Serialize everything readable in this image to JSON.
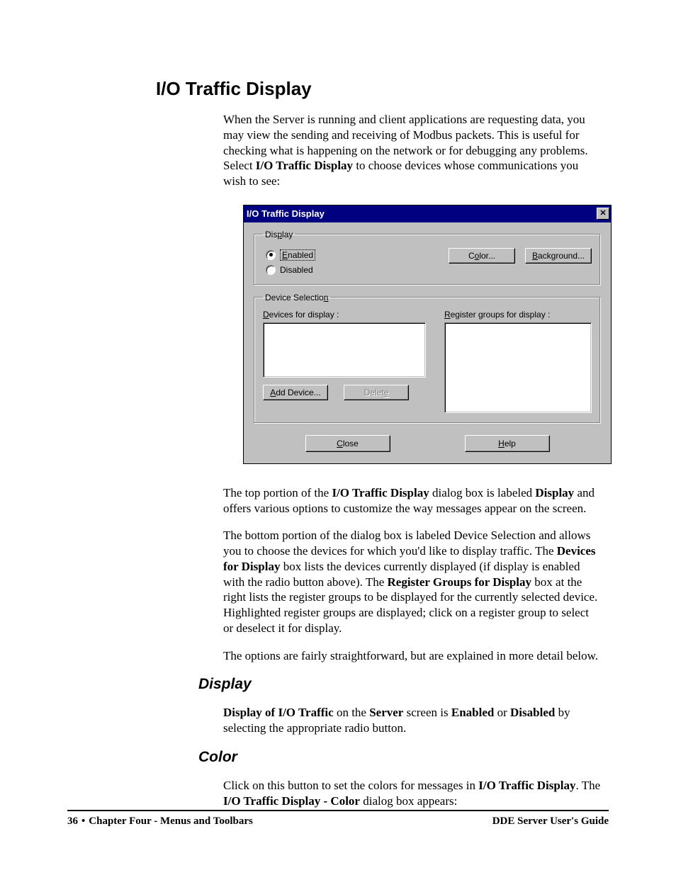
{
  "section_title": "I/O Traffic Display",
  "intro": {
    "pre": "When the Server is running and client applications are requesting data, you may view the sending and receiving of Modbus packets. This is useful for checking what is happening on the network or for debugging any problems. Select ",
    "bold": "I/O Traffic Display",
    "post": " to choose devices whose communications you wish to see:"
  },
  "dialog": {
    "title": "I/O Traffic Display",
    "display_group": {
      "legend_pre": "Dis",
      "legend_u": "p",
      "legend_post": "lay",
      "enabled_u": "E",
      "enabled_post": "nabled",
      "disabled_label": "Disabled",
      "color_pre": "C",
      "color_u": "o",
      "color_post": "lor...",
      "bg_u": "B",
      "bg_post": "ackground..."
    },
    "device_group": {
      "legend_pre": "Device Selectio",
      "legend_u": "n",
      "devices_u": "D",
      "devices_post": "evices for display :",
      "reg_u": "R",
      "reg_post": "egister groups for display :",
      "add_u": "A",
      "add_post": "dd Device...",
      "delete_pre": "Delet",
      "delete_u": "e"
    },
    "close_u": "C",
    "close_post": "lose",
    "help_u": "H",
    "help_post": "elp"
  },
  "para2": {
    "pre": "The top portion of the ",
    "b1": "I/O Traffic Display",
    "mid1": " dialog box is labeled ",
    "b2": "Display",
    "post": " and offers various options to customize the way messages appear on the screen."
  },
  "para3": {
    "pre": "The bottom portion of the dialog box is labeled Device Selection and allows you to choose the devices for which you'd like to display traffic. The ",
    "b1": "Devices for Display",
    "mid1": " box lists the devices currently displayed (if display is enabled with the radio button above). The ",
    "b2": "Register Groups for Display",
    "post": " box at the right lists the register groups to be displayed for the currently selected device. Highlighted register groups are displayed; click on a register group to select or deselect it for display."
  },
  "para4": "The options are fairly straightforward, but are explained in more detail below.",
  "sub_display": "Display",
  "para_display": {
    "b1": "Display of I/O Traffic",
    "mid1": " on the ",
    "b2": "Server",
    "mid2": " screen is ",
    "b3": "Enabled",
    "mid3": " or ",
    "b4": "Disabled",
    "post": " by selecting the appropriate radio button."
  },
  "sub_color": "Color",
  "para_color": {
    "pre": "Click on this button to set the colors for messages in ",
    "b1": "I/O Traffic Display",
    "mid": ". The ",
    "b2": "I/O Traffic Display - Color",
    "post": " dialog box appears:"
  },
  "footer": {
    "page_num": "36",
    "chapter": "Chapter Four - Menus and Toolbars",
    "guide": "DDE Server User's Guide"
  }
}
